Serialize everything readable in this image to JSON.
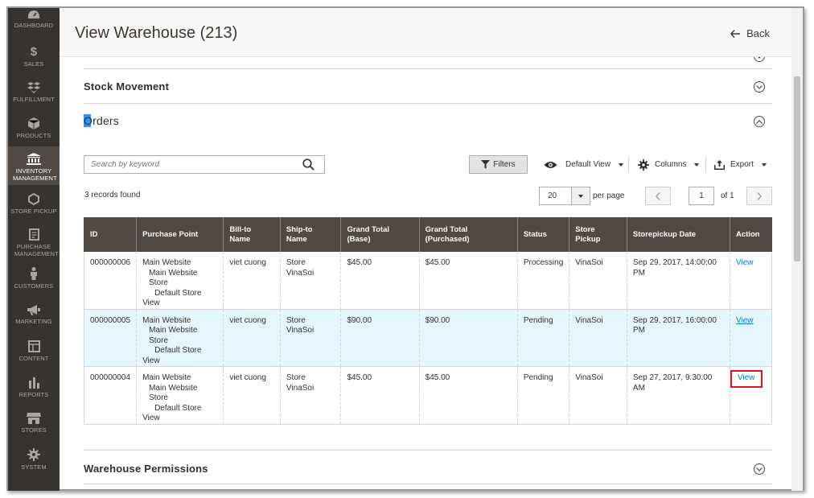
{
  "sidebar": {
    "items": [
      {
        "label": "DASHBOARD",
        "icon": "dashboard-icon"
      },
      {
        "label": "SALES",
        "icon": "dollar-icon"
      },
      {
        "label": "FULFILLMENT",
        "icon": "boxes-icon"
      },
      {
        "label": "PRODUCTS",
        "icon": "cube-icon"
      },
      {
        "label": "INVENTORY MANAGEMENT",
        "icon": "building-icon",
        "active": true
      },
      {
        "label": "STORE PICKUP",
        "icon": "hexagon-icon"
      },
      {
        "label": "PURCHASE MANAGEMENT",
        "icon": "document-icon"
      },
      {
        "label": "CUSTOMERS",
        "icon": "person-icon"
      },
      {
        "label": "MARKETING",
        "icon": "megaphone-icon"
      },
      {
        "label": "CONTENT",
        "icon": "layout-icon"
      },
      {
        "label": "REPORTS",
        "icon": "bar-chart-icon"
      },
      {
        "label": "STORES",
        "icon": "store-icon"
      },
      {
        "label": "SYSTEM",
        "icon": "gear-icon"
      }
    ]
  },
  "header": {
    "title": "View Warehouse (213)",
    "back_label": "Back"
  },
  "sections": {
    "stock_movement": "Stock Movement",
    "orders": "Orders",
    "warehouse_permissions": "Warehouse Permissions"
  },
  "toolbar": {
    "search_placeholder": "Search by keyword",
    "filters_label": "Filters",
    "default_view_label": "Default View",
    "columns_label": "Columns",
    "export_label": "Export",
    "records_found": "3 records found",
    "per_page_value": "20",
    "per_page_label": "per page",
    "page_value": "1",
    "page_of": "of 1"
  },
  "grid": {
    "headers": {
      "id": "ID",
      "purchase_point": "Purchase Point",
      "bill_to_1": "Bill-to",
      "bill_to_2": "Name",
      "ship_to_1": "Ship-to",
      "ship_to_2": "Name",
      "gt_base_1": "Grand Total",
      "gt_base_2": "(Base)",
      "gt_purch_1": "Grand Total",
      "gt_purch_2": "(Purchased)",
      "status": "Status",
      "store_pickup_1": "Store",
      "store_pickup_2": "Pickup",
      "pickup_date": "Storepickup Date",
      "action": "Action"
    },
    "rows": [
      {
        "id": "000000006",
        "pp_1": "Main Website",
        "pp_2": "Main Website Store",
        "pp_3": "Default Store",
        "pp_4": "View",
        "bill_to": "viet cuong",
        "ship_to": "Store VinaSoi",
        "gt_base": "$45.00",
        "gt_purchased": "$45.00",
        "status": "Processing",
        "store_pickup": "VinaSoi",
        "pickup_date_1": "Sep 29, 2017, 14:00:00",
        "pickup_date_2": "PM",
        "action": "View"
      },
      {
        "id": "000000005",
        "pp_1": "Main Website",
        "pp_2": "Main Website Store",
        "pp_3": "Default Store",
        "pp_4": "View",
        "bill_to": "viet cuong",
        "ship_to": "Store VinaSoi",
        "gt_base": "$90.00",
        "gt_purchased": "$90.00",
        "status": "Pending",
        "store_pickup": "VinaSoi",
        "pickup_date_1": "Sep 29, 2017, 16:00:00",
        "pickup_date_2": "PM",
        "action": "View"
      },
      {
        "id": "000000004",
        "pp_1": "Main Website",
        "pp_2": "Main Website Store",
        "pp_3": "Default Store",
        "pp_4": "View",
        "bill_to": "viet cuong",
        "ship_to": "Store VinaSoi",
        "gt_base": "$45.00",
        "gt_purchased": "$45.00",
        "status": "Pending",
        "store_pickup": "VinaSoi",
        "pickup_date_1": "Sep 27, 2017, 9:30:00 AM",
        "pickup_date_2": "",
        "action": "View"
      }
    ]
  },
  "colors": {
    "sidebar_bg": "#373330",
    "header_row_bg": "#514943",
    "link": "#007bdb",
    "highlight_row": "#e5f7fe",
    "annotation_red": "#e0141b"
  }
}
